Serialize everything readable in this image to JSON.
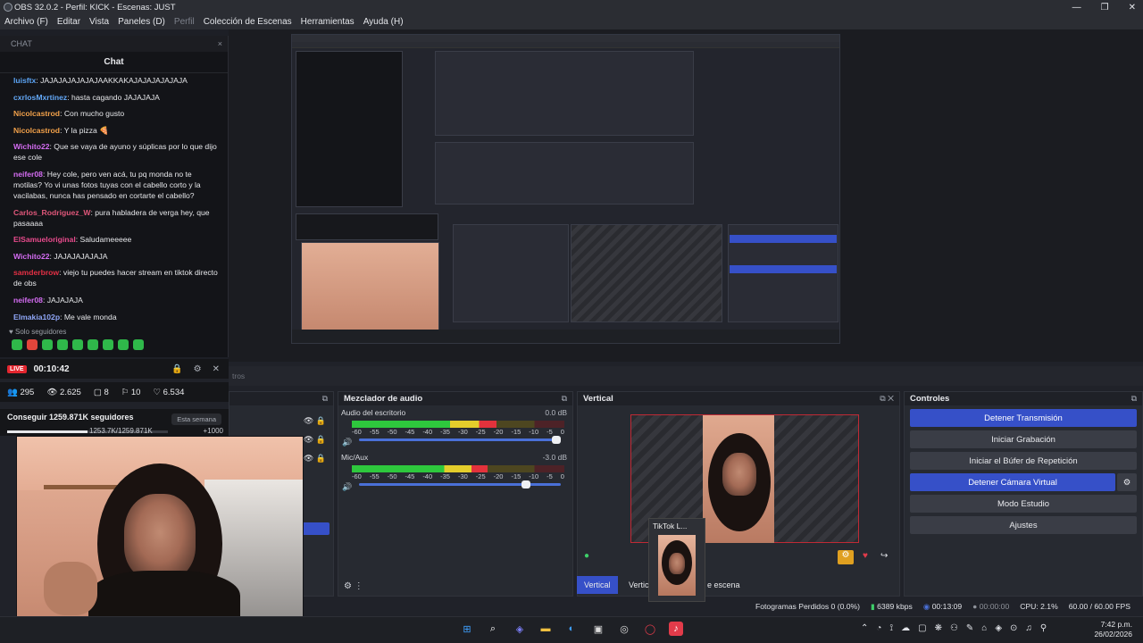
{
  "window": {
    "title": "OBS 32.0.2 - Perfil: KICK - Escenas: JUST",
    "minimize": "—",
    "maximize": "❐",
    "close": "✕"
  },
  "menu": [
    "Archivo (F)",
    "Editar",
    "Vista",
    "Paneles (D)",
    "Perfil",
    "Colección de Escenas",
    "Herramientas",
    "Ayuda (H)"
  ],
  "chat": {
    "dock_label": "CHAT",
    "title": "Chat",
    "messages": [
      {
        "user": "luisftx",
        "color": "#5ba4f5",
        "text": "JAJAJAJAJAJAJAAKKAKAJAJAJAJAJAJA"
      },
      {
        "user": "cxrlosMxrtinez",
        "color": "#63a8f7",
        "text": "hasta cagando JAJAJAJA"
      },
      {
        "user": "Nicolcastrod",
        "color": "#f2a14a",
        "text": "Con mucho gusto"
      },
      {
        "user": "Nicolcastrod",
        "color": "#f2a14a",
        "text": "Y la pizza 🍕"
      },
      {
        "user": "Wichito22",
        "color": "#d46cf2",
        "text": "Que se vaya de ayuno y súplicas por lo que dijo ese cole"
      },
      {
        "user": "neifer08",
        "color": "#d46cf2",
        "text": "Hey cole, pero ven acá, tu pq monda no te motilas? Yo vi unas fotos tuyas con el cabello corto y la vacilabas, nunca has pensado en cortarte el cabello?"
      },
      {
        "user": "Carlos_Rodriguez_W",
        "color": "#e0577a",
        "text": "pura habladera de verga hey, que pasaaaa"
      },
      {
        "user": "ElSamueloriginal",
        "color": "#e94b8d",
        "text": "Saludameeeee"
      },
      {
        "user": "Wichito22",
        "color": "#d46cf2",
        "text": "JAJAJAJAJAJA"
      },
      {
        "user": "samderbrow",
        "color": "#e53045",
        "text": "viejo tu puedes hacer stream en tiktok directo de obs"
      },
      {
        "user": "neifer08",
        "color": "#d46cf2",
        "text": "JAJAJAJA"
      },
      {
        "user": "Elmakia102p",
        "color": "#8fa6f7",
        "text": "Me vale monda"
      }
    ],
    "footer": "Solo seguidores"
  },
  "live": {
    "badge": "LIVE",
    "time": "00:10:42"
  },
  "stats": {
    "viewers": "295",
    "views": "2.625",
    "saves": "8",
    "gifts": "10",
    "likes": "6.534"
  },
  "goal": {
    "label": "Conseguir 1259.871K seguidores",
    "button": "Esta semana",
    "progress": "1253.7K/1259.871K",
    "delta": "+1000"
  },
  "scene_tab": "tros",
  "mixer": {
    "title": "Mezclador de audio",
    "channels": [
      {
        "name": "Audio del escritorio",
        "db": "0.0 dB",
        "level": 0.68,
        "volume": 1.0
      },
      {
        "name": "Mic/Aux",
        "db": "-3.0 dB",
        "level": 0.64,
        "volume": 0.85
      }
    ],
    "ticks": [
      "-60",
      "-55",
      "-50",
      "-45",
      "-40",
      "-35",
      "-30",
      "-25",
      "-20",
      "-15",
      "-10",
      "-5",
      "0"
    ]
  },
  "vertical": {
    "title": "Vertical",
    "tab1": "Vertical",
    "tab2": "Vertic",
    "tab3": "e escena",
    "tiktok": "TikTok L..."
  },
  "controls": {
    "title": "Controles",
    "buttons": [
      {
        "label": "Detener Transmisión",
        "active": true
      },
      {
        "label": "Iniciar Grabación",
        "active": false
      },
      {
        "label": "Iniciar el Búfer de Repetición",
        "active": false
      },
      {
        "label": "Detener Cámara Virtual",
        "active": true
      },
      {
        "label": "Modo Estudio",
        "active": false
      },
      {
        "label": "Ajustes",
        "active": false
      }
    ]
  },
  "status": {
    "dropped": "Fotogramas Perdidos 0 (0.0%)",
    "kbps": "6389 kbps",
    "stream_time": "00:13:09",
    "rec_time": "00:00:00",
    "cpu": "CPU: 2.1%",
    "fps": "60.00 / 60.00 FPS"
  },
  "clock": {
    "time": "7:42 p.m.",
    "date": "26/02/2026"
  },
  "colors": {
    "accent": "#3650c8",
    "live": "#e3262f"
  }
}
